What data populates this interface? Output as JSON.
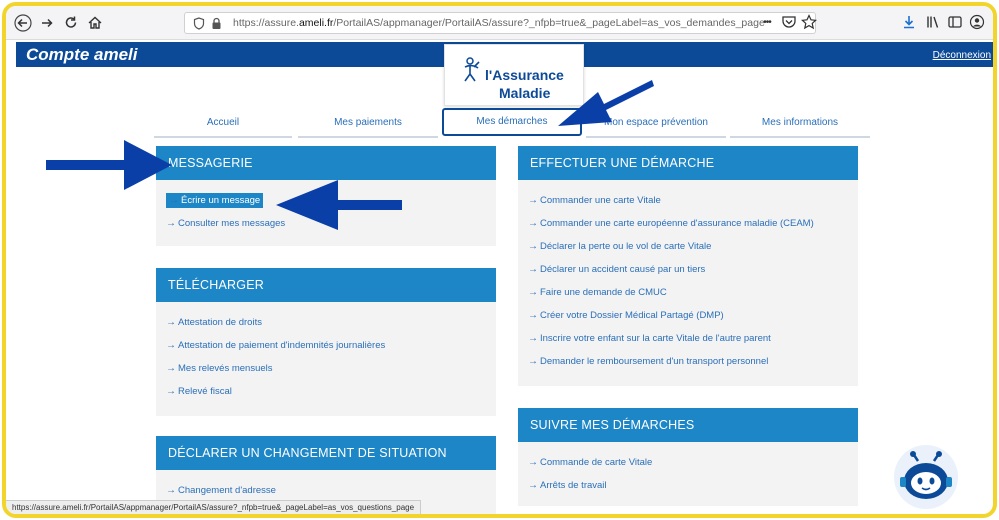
{
  "browser": {
    "url_prefix": "https://assure.",
    "url_host": "ameli.fr",
    "url_rest": "/PortailAS/appmanager/PortailAS/assure?_nfpb=true&_pageLabel=as_vos_demandes_page",
    "more_label": "•••",
    "status_url": "https://assure.ameli.fr/PortailAS/appmanager/PortailAS/assure?_nfpb=true&_pageLabel=as_vos_questions_page"
  },
  "header": {
    "brand": "Compte ameli",
    "logout_label": "Déconnexion",
    "logo_line1": "l'Assurance",
    "logo_line2": "Maladie"
  },
  "nav": {
    "tabs": [
      {
        "label": "Accueil"
      },
      {
        "label": "Mes paiements"
      },
      {
        "label": "Mes démarches",
        "active": true
      },
      {
        "label": "Mon espace prévention"
      },
      {
        "label": "Mes informations"
      }
    ]
  },
  "panels": {
    "messagerie": {
      "title": "MESSAGERIE",
      "items": [
        "Écrire un message",
        "Consulter mes messages"
      ]
    },
    "telecharger": {
      "title": "TÉLÉCHARGER",
      "items": [
        "Attestation de droits",
        "Attestation de paiement d'indemnités journalières",
        "Mes relevés mensuels",
        "Relevé fiscal"
      ]
    },
    "declarer": {
      "title": "DÉCLARER UN CHANGEMENT DE SITUATION",
      "items": [
        "Changement d'adresse"
      ]
    },
    "effectuer": {
      "title": "EFFECTUER UNE DÉMARCHE",
      "items": [
        "Commander une carte Vitale",
        "Commander une carte européenne d'assurance maladie (CEAM)",
        "Déclarer la perte ou le vol de carte Vitale",
        "Déclarer un accident causé par un tiers",
        "Faire une demande de CMUC",
        "Créer votre Dossier Médical Partagé (DMP)",
        "Inscrire votre enfant sur la carte Vitale de l'autre parent",
        "Demander le remboursement d'un transport personnel"
      ]
    },
    "suivre": {
      "title": "SUIVRE MES DÉMARCHES",
      "items": [
        "Commande de carte Vitale",
        "Arrêts de travail"
      ]
    }
  },
  "colors": {
    "header_blue": "#0c4a98",
    "panel_blue": "#1d86c6",
    "link_blue": "#2a6fb8",
    "annotation_blue": "#0b3fa8",
    "frame_yellow": "#f2d52c"
  }
}
